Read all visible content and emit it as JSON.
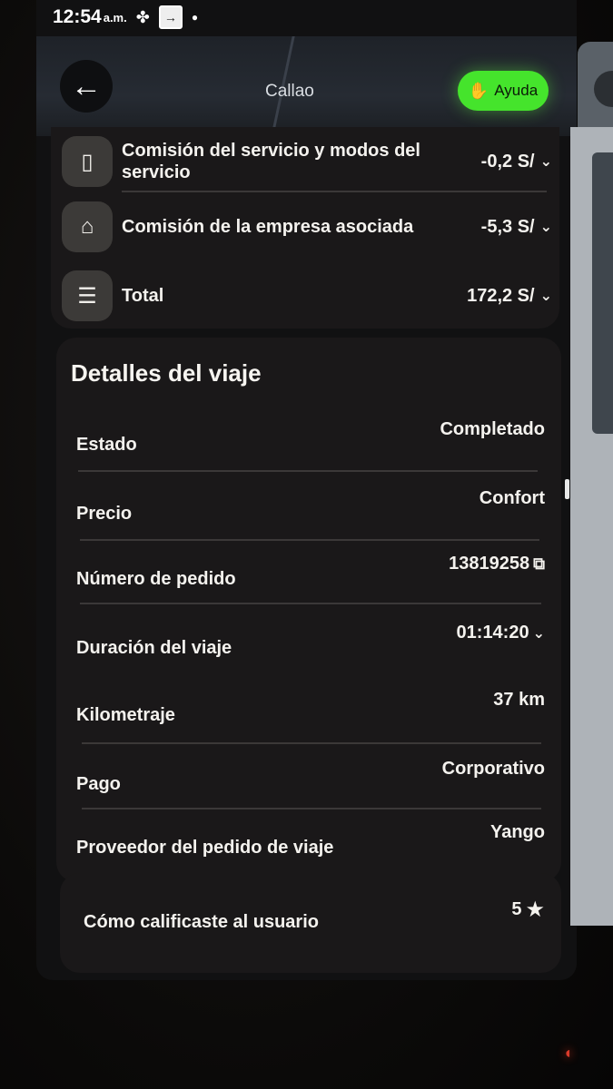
{
  "status_bar": {
    "time": "12:54",
    "ampm": "a.m.",
    "icons": [
      "fan-icon",
      "exit-box-icon",
      "dot-icon"
    ]
  },
  "header": {
    "back_icon": "arrow-left-icon",
    "map_city": "Callao",
    "help_label": "Ayuda",
    "help_icon": "waving-hand-icon",
    "help_color": "#45e42c"
  },
  "fees": [
    {
      "icon": "phone-wallet-icon",
      "label": "Comisión del servicio y modos del servicio",
      "value": "-0,2 S/"
    },
    {
      "icon": "company-icon",
      "label": "Comisión de la empresa asociada",
      "value": "-5,3 S/"
    },
    {
      "icon": "receipt-icon",
      "label": "Total",
      "value": "172,2 S/"
    }
  ],
  "trip": {
    "title": "Detalles del viaje",
    "rows": [
      {
        "key": "Estado",
        "value": "Completado"
      },
      {
        "key": "Precio",
        "value": "Confort"
      },
      {
        "key": "Número de pedido",
        "value": "13819258"
      },
      {
        "key": "Duración del viaje",
        "value": "01:14:20"
      },
      {
        "key": "Kilometraje",
        "value": "37 km"
      },
      {
        "key": "Pago",
        "value": "Corporativo"
      },
      {
        "key": "Proveedor del pedido de viaje",
        "value": "Yango"
      }
    ]
  },
  "rating": {
    "label": "Cómo calificaste al usuario",
    "value": "5"
  }
}
